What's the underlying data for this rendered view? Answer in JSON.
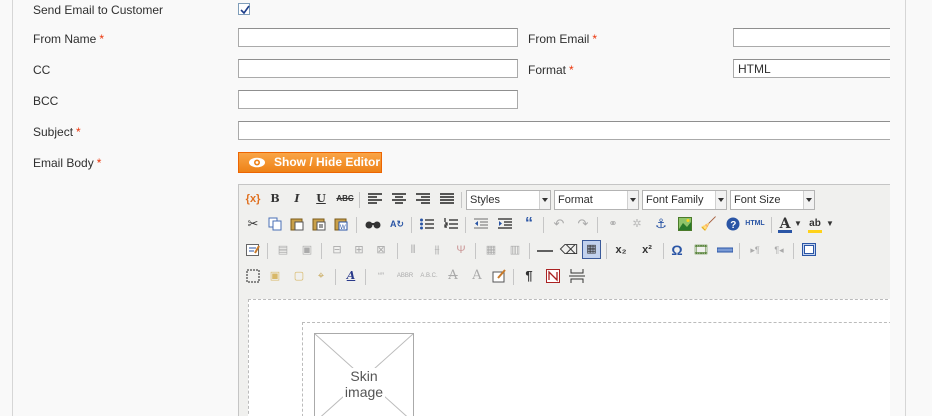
{
  "form": {
    "send_email_label": "Send Email to Customer",
    "send_email_checked": true,
    "from_name_label": "From Name",
    "from_email_label": "From Email",
    "cc_label": "CC",
    "format_label": "Format",
    "format_value": "HTML",
    "bcc_label": "BCC",
    "subject_label": "Subject",
    "email_body_label": "Email Body",
    "required_mark": "*",
    "show_hide_label": "Show / Hide Editor"
  },
  "editor": {
    "styles": "Styles",
    "format": "Format",
    "font_family": "Font Family",
    "font_size": "Font Size",
    "skin_image_line1": "Skin",
    "skin_image_line2": "image",
    "icons_row1": [
      "variable-icon",
      "bold-icon",
      "italic-icon",
      "underline-icon",
      "strikethrough-icon",
      "align-left-icon",
      "align-center-icon",
      "align-right-icon",
      "align-justify-icon"
    ],
    "icons_row2": [
      "cut-icon",
      "copy-icon",
      "paste-icon",
      "paste-text-icon",
      "paste-word-icon",
      "find-icon",
      "replace-icon",
      "bullet-list-icon",
      "numbered-list-icon",
      "outdent-icon",
      "indent-icon",
      "blockquote-icon",
      "undo-icon",
      "redo-icon",
      "link-icon",
      "unlink-icon",
      "anchor-icon",
      "image-icon",
      "cleanup-icon",
      "help-icon",
      "html-icon",
      "text-color-icon",
      "highlight-color-icon"
    ],
    "icons_row3": [
      "insert-table-icon",
      "table-row-props-icon",
      "table-cell-props-icon",
      "insert-row-before-icon",
      "insert-row-after-icon",
      "delete-row-icon",
      "insert-col-before-icon",
      "insert-col-after-icon",
      "delete-col-icon",
      "split-cells-icon",
      "merge-cells-icon",
      "horizontal-rule-icon",
      "remove-format-icon",
      "visual-aid-icon",
      "subscript-icon",
      "superscript-icon",
      "special-char-icon",
      "media-icon",
      "advanced-hr-icon",
      "ltr-icon",
      "rtl-icon",
      "fullscreen-icon"
    ],
    "icons_row4": [
      "insert-layer-icon",
      "move-forward-icon",
      "move-backward-icon",
      "absolute-icon",
      "styleprops-icon",
      "cite-icon",
      "abbr-icon",
      "acronym-icon",
      "del-icon",
      "ins-icon",
      "attribs-icon",
      "show-blocks-icon",
      "nonbreaking-icon",
      "pagebreak-icon"
    ],
    "text_bold": "B",
    "text_italic": "I",
    "text_underline": "U",
    "text_strike": "ABC",
    "text_html": "HTML",
    "text_sub": "x₂",
    "text_sup": "x²",
    "text_omega": "Ω",
    "text_color_a": "A",
    "text_abc": "ab",
    "text_pilcrow": "¶",
    "text_cite": "“”",
    "text_abbr": "ABBR",
    "text_acronym": "A.B.C.",
    "text_del": "A",
    "text_ins": "A"
  },
  "colors": {
    "required": "#eb340a",
    "button": "#ee8217"
  }
}
